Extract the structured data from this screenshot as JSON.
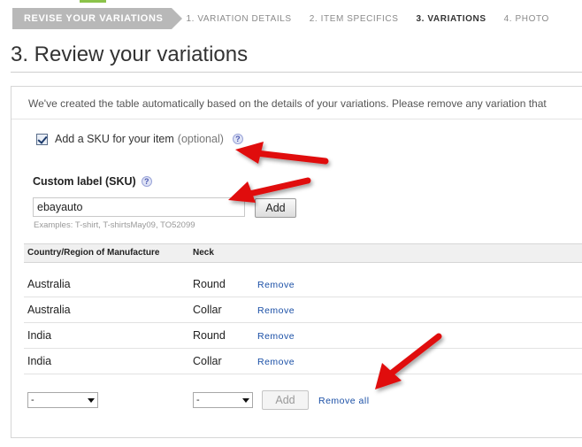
{
  "steps": {
    "current_section": "REVISE YOUR VARIATIONS",
    "items": [
      "1. VARIATION DETAILS",
      "2. ITEM SPECIFICS",
      "3. VARIATIONS",
      "4. PHOTO"
    ]
  },
  "page_title": "3. Review your variations",
  "intro_text": "We've created the table automatically based on the details of your variations. Please remove any variation that",
  "sku_option": {
    "checked": true,
    "label": "Add a SKU for your item",
    "optional": "(optional)",
    "help": "?"
  },
  "custom_label": {
    "title": "Custom label (SKU)",
    "help": "?",
    "value": "ebayauto",
    "add_label": "Add",
    "examples": "Examples: T-shirt, T-shirtsMay09, TO52099"
  },
  "table": {
    "headers": [
      "Country/Region of Manufacture",
      "Neck"
    ],
    "rows": [
      {
        "country": "Australia",
        "neck": "Round",
        "action": "Remove"
      },
      {
        "country": "Australia",
        "neck": "Collar",
        "action": "Remove"
      },
      {
        "country": "India",
        "neck": "Round",
        "action": "Remove"
      },
      {
        "country": "India",
        "neck": "Collar",
        "action": "Remove"
      }
    ],
    "new_row": {
      "country_select": "-",
      "neck_select": "-",
      "add_label": "Add",
      "remove_all": "Remove all"
    }
  },
  "colors": {
    "link": "#1a4fa6",
    "annotation_arrow": "#e01010",
    "step_bar": "#b8b8b8"
  }
}
